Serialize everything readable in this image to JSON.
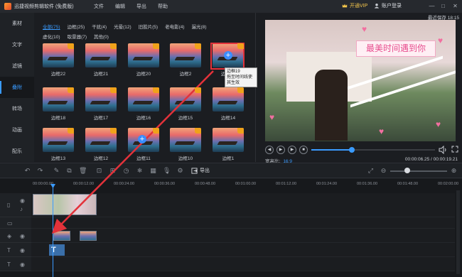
{
  "titlebar": {
    "app_title": "迅捷视频剪辑软件 (免费版)",
    "menus": [
      "文件",
      "编辑",
      "导出",
      "帮助"
    ],
    "vip_label": "开通VIP",
    "login_label": "账户登录",
    "minimize": "—",
    "maximize": "□",
    "close": "✕"
  },
  "sidebar": {
    "items": [
      {
        "label": "素材",
        "active": false
      },
      {
        "label": "文字",
        "active": false
      },
      {
        "label": "滤镜",
        "active": false
      },
      {
        "label": "叠附",
        "active": true
      },
      {
        "label": "转场",
        "active": false
      },
      {
        "label": "动画",
        "active": false
      },
      {
        "label": "配乐",
        "active": false
      }
    ]
  },
  "categories": {
    "row1": [
      "全部(75)",
      "边框(25)",
      "干扰(4)",
      "光晕(12)",
      "旧胶片(5)",
      "老电影(4)",
      "漏光(8)"
    ],
    "row2": [
      "虚化(10)",
      "取景器(7)",
      "其他(0)"
    ]
  },
  "overlays": [
    {
      "label": "边框22"
    },
    {
      "label": "边框21"
    },
    {
      "label": "边框20"
    },
    {
      "label": "边框2"
    },
    {
      "label": "边框19"
    },
    {
      "label": "边框18"
    },
    {
      "label": "边框17"
    },
    {
      "label": "边框16"
    },
    {
      "label": "边框15"
    },
    {
      "label": "边框14"
    },
    {
      "label": "边框13"
    },
    {
      "label": "边框12"
    },
    {
      "label": "边框11"
    },
    {
      "label": "边框10"
    },
    {
      "label": "边框1"
    }
  ],
  "tooltip": {
    "line1": "边框19",
    "line2": "拖至时间线使其生效"
  },
  "preview": {
    "save_info": "最近保存 18:15",
    "overlay_text": "最美时间遇到你",
    "progress": 0.33,
    "ratio_label": "宽高比:",
    "ratio_value": "16:9",
    "time_readout": "00:00:06.25 / 00:00:19.21"
  },
  "toolbar": {
    "export_label": "导出"
  },
  "timeline": {
    "ruler": [
      "00:00:00.00",
      "00:00:12.00",
      "00:00:24.00",
      "00:00:36.00",
      "00:00:48.00",
      "00:01:00.00",
      "00:01:12.00",
      "00:01:24.00",
      "00:01:36.00",
      "00:01:48.00",
      "00:02:00.00"
    ],
    "zoom_level": 0.3
  },
  "colors": {
    "accent": "#3a9bff",
    "vip": "#f3c54b",
    "highlight": "#e3323a"
  }
}
